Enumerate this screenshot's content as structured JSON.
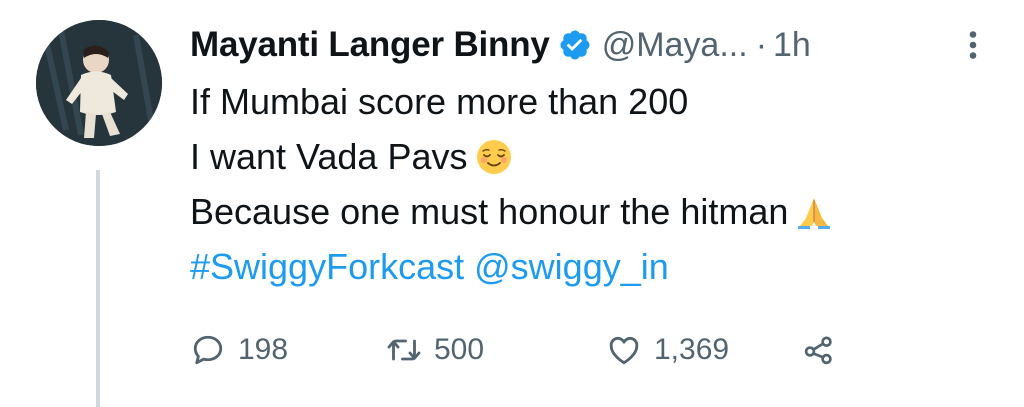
{
  "tweet": {
    "author_name": "Mayanti Langer Binny",
    "handle": "@Maya...",
    "separator": "·",
    "time": "1h",
    "lines": [
      "If Mumbai score more than 200",
      "I want Vada Pavs",
      "Because one must honour the hitman"
    ],
    "hashtag": "#SwiggyForkcast",
    "mention": "@swiggy_in",
    "emojis": [
      "relieved-face-emoji",
      "folded-hands-emoji"
    ]
  },
  "actions": {
    "replies": "198",
    "retweets": "500",
    "likes": "1,369"
  },
  "colors": {
    "text": "#0f1419",
    "secondary": "#536471",
    "link": "#1d9bf0",
    "verified": "#1d9bf0",
    "thread_line": "#cfd9de"
  }
}
